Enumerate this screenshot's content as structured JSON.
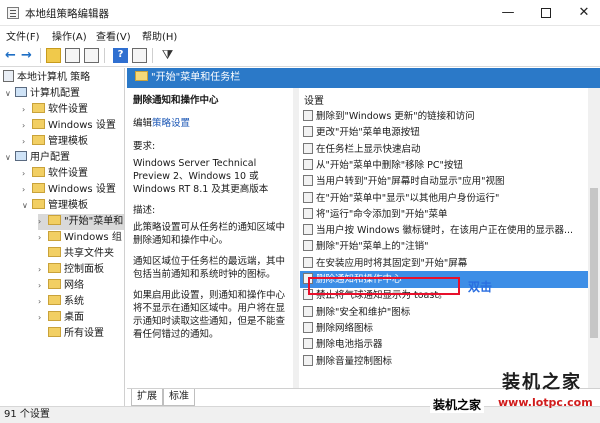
{
  "window": {
    "title": "本地组策略编辑器"
  },
  "menu": [
    "文件(F)",
    "操作(A)",
    "查看(V)",
    "帮助(H)"
  ],
  "tree": {
    "root": "本地计算机 策略",
    "computer_config": "计算机配置",
    "cc_software": "软件设置",
    "cc_windows": "Windows 设置",
    "cc_admin": "管理模板",
    "user_config": "用户配置",
    "uc_software": "软件设置",
    "uc_windows": "Windows 设置",
    "uc_admin": "管理模板",
    "start_menu": "\"开始\"菜单和",
    "windows_comp": "Windows 组",
    "shared_folders": "共享文件夹",
    "control_panel": "控制面板",
    "network": "网络",
    "system": "系统",
    "desktop": "桌面",
    "all_settings": "所有设置"
  },
  "header": {
    "title": "\"开始\"菜单和任务栏"
  },
  "description": {
    "title": "删除通知和操作中心",
    "edit_prefix": "编辑",
    "edit_link": "策略设置",
    "requirements_label": "要求:",
    "requirements_text": "Windows Server Technical Preview 2、Windows 10 或 Windows RT 8.1 及其更高版本",
    "desc_label": "描述:",
    "desc_text": "此策略设置可从任务栏的通知区域中删除通知和操作中心。",
    "desc_para2": "通知区域位于任务栏的最远端，其中包括当前通知和系统时钟的图标。",
    "desc_para3": "如果启用此设置，则通知和操作中心将不显示在通知区域中。用户将在显示通知时读取这些通知，但是不能查看任何错过的通知。"
  },
  "settings": {
    "header": "设置",
    "items": [
      "删除到\"Windows 更新\"的链接和访问",
      "更改\"开始\"菜单电源按钮",
      "在任务栏上显示快速启动",
      "从\"开始\"菜单中删除\"移除 PC\"按钮",
      "当用户转到\"开始\"屏幕时自动显示\"应用\"视图",
      "在\"开始\"菜单中\"显示\"以其他用户身份运行\"",
      "将\"运行\"命令添加到\"开始\"菜单",
      "当用户按 Windows 徽标键时，在该用户正在使用的显示器...",
      "删除\"开始\"菜单上的\"注销\"",
      "在安装应用时将其固定到\"开始\"屏幕",
      "删除通知和操作中心",
      "禁止将气球通知显示为 toast。",
      "删除\"安全和维护\"图标",
      "删除网络图标",
      "删除电池指示器",
      "删除音量控制图标"
    ],
    "highlighted_index": 10
  },
  "annotation": "双击",
  "tabs": [
    "扩展",
    "标准"
  ],
  "status": "91 个设置",
  "watermark": {
    "big": "装机之家",
    "small": "装机之家",
    "url": "www.lotpc.com"
  }
}
